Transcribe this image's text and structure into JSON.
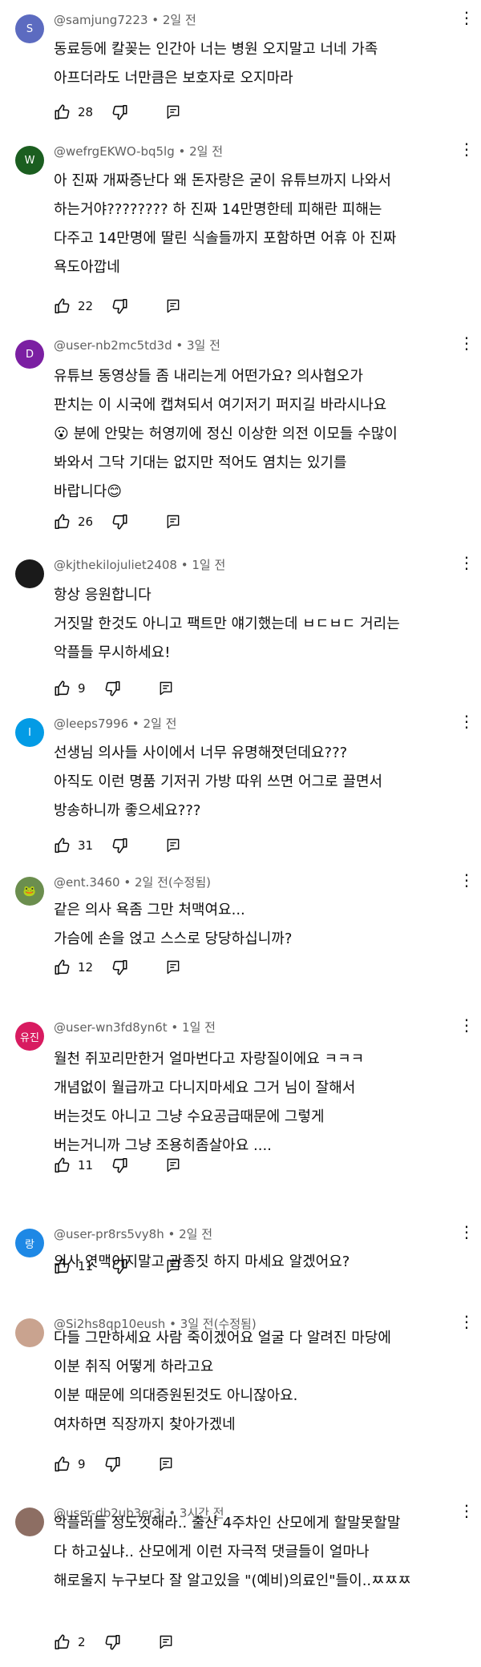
{
  "comments": [
    {
      "author": "@samjung7223",
      "time": "2일 전",
      "edited": "",
      "avatar_text": "S",
      "avatar_color": "#5c6bc0",
      "lines": [
        "동료등에 칼꽂는 인간아 너는 병원 오지말고 너네 가족",
        "아프더라도 너만큼은 보호자로 오지마라"
      ],
      "likes": "28"
    },
    {
      "author": "@wefrgEKWO-bq5lg",
      "time": "2일 전",
      "edited": "",
      "avatar_text": "W",
      "avatar_color": "#1b5e20",
      "lines": [
        "아 진짜 개짜증난다 왜 돈자랑은 굳이 유튜브까지 나와서",
        "하는거야???????? 하 진짜 14만명한테 피해란 피해는",
        "다주고 14만명에 딸린 식솔들까지 포함하면 어휴 아 진짜",
        "욕도아깝네"
      ],
      "likes": "22"
    },
    {
      "author": "@user-nb2mc5td3d",
      "time": "3일 전",
      "edited": "",
      "avatar_text": "D",
      "avatar_color": "#7b1fa2",
      "lines": [
        "유튜브 동영상들 좀 내리는게 어떤가요? 의사협오가",
        "판치는 이 시국에 캡쳐되서 여기저기 퍼지길 바라시나요",
        "😮 분에 안맞는 허영끼에 정신 이상한 의전 이모들 수많이",
        "봐와서 그닥 기대는 없지만 적어도 염치는 있기를",
        "바랍니다😊"
      ],
      "likes": "26"
    },
    {
      "author": "@kjthekilojuliet2408",
      "time": "1일 전",
      "edited": "",
      "avatar_text": "",
      "avatar_color": "#1a1a1a",
      "lines": [
        "항상 응원합니다",
        "거짓말 한것도 아니고 팩트만 얘기했는데 ㅂㄷㅂㄷ 거리는",
        "악플들 무시하세요!"
      ],
      "likes": "9"
    },
    {
      "author": "@leeps7996",
      "time": "2일 전",
      "edited": "",
      "avatar_text": "I",
      "avatar_color": "#039be5",
      "lines": [
        "선생님 의사들 사이에서 너무 유명해졋던데요???",
        "아직도 이런 명품 기저귀 가방 따위 쓰면 어그로 끌면서",
        "방송하니까 좋으세요???"
      ],
      "likes": "31"
    },
    {
      "author": "@ent.3460",
      "time": "2일 전",
      "edited": "(수정됨)",
      "avatar_text": "🐸",
      "avatar_color": "#6b8e4e",
      "lines": [
        "같은 의사 욕좀 그만 처맥여요...",
        "가슴에 손을 얹고 스스로 당당하십니까?"
      ],
      "likes": "12"
    },
    {
      "author": "@user-wn3fd8yn6t",
      "time": "1일 전",
      "edited": "",
      "avatar_text": "유진",
      "avatar_color": "#d81b60",
      "lines": [
        "월천 쥐꼬리만한거 얼마번다고 자랑질이에요 ㅋㅋㅋ",
        "개념없이 월급까고 다니지마세요 그거 님이 잘해서",
        "버는것도 아니고 그냥 수요공급때문에 그렇게",
        "버는거니까 그냥 조용히좀살아요 ...."
      ],
      "likes": "11"
    },
    {
      "author": "@user-pr8rs5vy8h",
      "time": "2일 전",
      "edited": "",
      "avatar_text": "랑",
      "avatar_color": "#1e88e5",
      "lines": [
        "의사 엿맥이지말고 관종짓 하지 마세요 알겠어요?"
      ],
      "likes": "11"
    },
    {
      "author": "@Si2hs8qp10eush",
      "time": "3일 전",
      "edited": "(수정됨)",
      "avatar_text": "",
      "avatar_color": "#c9a38f",
      "lines": [
        "다들 그만하세요 사람 죽이겠어요 얼굴 다 알려진 마당에",
        "이분 취직 어떻게 하라고요",
        "이분 때문에 의대증원된것도 아니잖아요.",
        "여차하면 직장까지 찾아가겠네"
      ],
      "likes": "9"
    },
    {
      "author": "@user-db2ub3er3i",
      "time": "3시간 전",
      "edited": "",
      "avatar_text": "",
      "avatar_color": "#8d6e63",
      "lines": [
        "악플러들 정도껏해라.. 출산 4주차인 산모에게 할말못할말",
        "다 하고싶냐.. 산모에게 이런 자극적 댓글들이 얼마나",
        "해로울지 누구보다 잘 알고있을 \"(예비)의료인\"들이..ㅉㅉㅉ"
      ],
      "likes": "2"
    }
  ]
}
